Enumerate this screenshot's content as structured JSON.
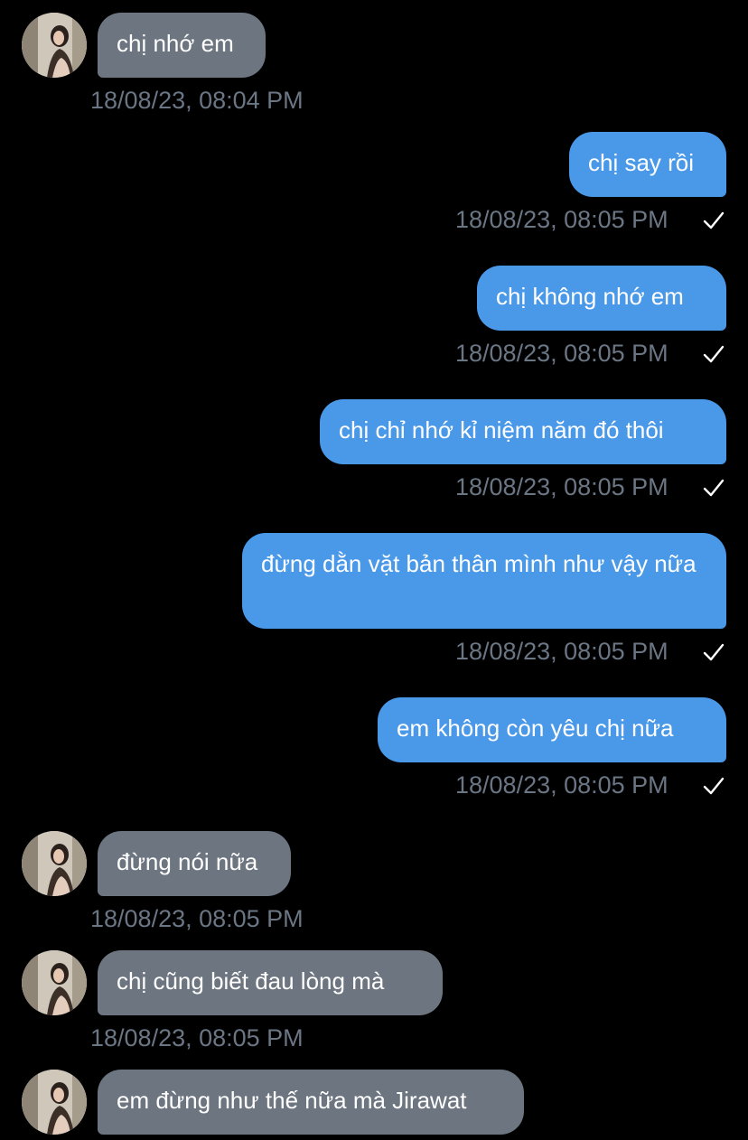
{
  "conversation": {
    "messages": [
      {
        "direction": "incoming",
        "text": "chị nhớ em",
        "time": "18/08/23, 08:04 PM"
      },
      {
        "direction": "outgoing",
        "text": "chị say rồi",
        "time": "18/08/23, 08:05 PM",
        "status": "sent"
      },
      {
        "direction": "outgoing",
        "text": "chị không nhớ em",
        "time": "18/08/23, 08:05 PM",
        "status": "sent"
      },
      {
        "direction": "outgoing",
        "text": "chị chỉ nhớ kỉ niệm năm đó thôi",
        "time": "18/08/23, 08:05 PM",
        "status": "sent"
      },
      {
        "direction": "outgoing",
        "text": "đừng dằn vặt bản thân mình như vậy nữa",
        "time": "18/08/23, 08:05 PM",
        "status": "sent"
      },
      {
        "direction": "outgoing",
        "text": "em không còn yêu chị nữa",
        "time": "18/08/23, 08:05 PM",
        "status": "sent"
      },
      {
        "direction": "incoming",
        "text": "đừng nói nữa",
        "time": "18/08/23, 08:05 PM"
      },
      {
        "direction": "incoming",
        "text": "chị cũng biết đau lòng mà",
        "time": "18/08/23, 08:05 PM"
      },
      {
        "direction": "incoming",
        "text": "em đừng như thế nữa mà Jirawat",
        "time": ""
      }
    ]
  },
  "icons": {
    "sent_status": "checkmark-icon",
    "contact_avatar": "avatar"
  },
  "colors": {
    "background": "#000000",
    "incoming_bubble": "#6c7580",
    "outgoing_bubble": "#4a99e9",
    "timestamp": "#6b7685",
    "check": "#ffffff"
  }
}
